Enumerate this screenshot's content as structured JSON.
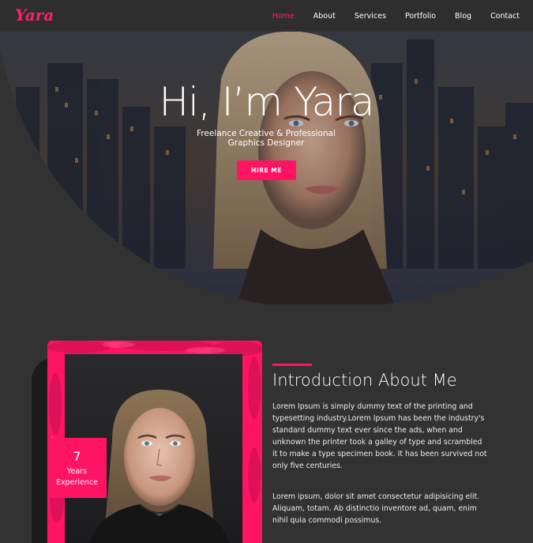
{
  "nav": {
    "logo_text": "Yara",
    "links": [
      {
        "label": "Home",
        "active": true
      },
      {
        "label": "About",
        "active": false
      },
      {
        "label": "Services",
        "active": false
      },
      {
        "label": "Portfolio",
        "active": false
      },
      {
        "label": "Blog",
        "active": false
      },
      {
        "label": "Contact",
        "active": false
      }
    ]
  },
  "hero": {
    "title": "Hi, I’m Yara",
    "subtitle_line1": "Freelance Creative & Professional",
    "subtitle_line2": "Graphics Designer",
    "cta_label": "HIRE ME"
  },
  "about": {
    "experience_number": "7",
    "experience_line1": "Years",
    "experience_line2": "Experience",
    "title": "Introduction About Me",
    "paragraph1": "Lorem Ipsum is simply dummy text of the printing and typesetting industry.Lorem Ipsum has been the industry's standard dummy text ever since the ads, when and unknown the printer took a galley of type and scrambled it to make a type specimen book. It has been survived not only five centuries.",
    "paragraph2": "Lorem ipsum, dolor sit amet consectetur adipisicing elit. Aliquam, totam. Ab distinctio inventore ad, quam, enim nihil quia commodi possimus."
  },
  "colors": {
    "accent": "#ff1464",
    "background": "#333232",
    "nav_background": "#2f2e2e"
  }
}
